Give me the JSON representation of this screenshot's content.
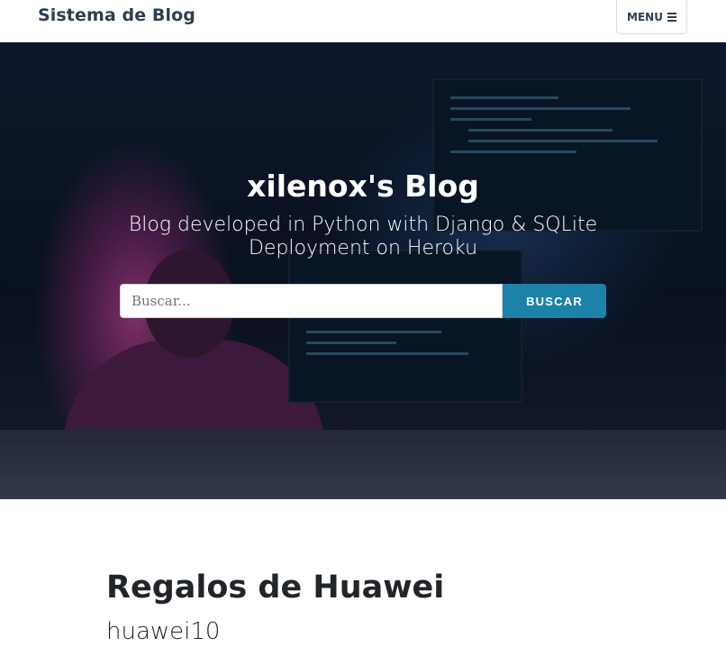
{
  "navbar": {
    "brand": "Sistema de Blog",
    "menu_label": "MENU"
  },
  "hero": {
    "title": "xilenox's Blog",
    "subtitle_line1": "Blog developed in Python with Django & SQLite",
    "subtitle_line2": "Deployment on Heroku",
    "search": {
      "placeholder": "Buscar...",
      "value": "",
      "button_label": "BUSCAR"
    }
  },
  "post": {
    "title": "Regalos de Huawei",
    "subtitle": "huawei10"
  },
  "colors": {
    "accent": "#1c82a8",
    "brand_text": "#2c3e50"
  },
  "icons": {
    "menu": "bars-icon"
  }
}
